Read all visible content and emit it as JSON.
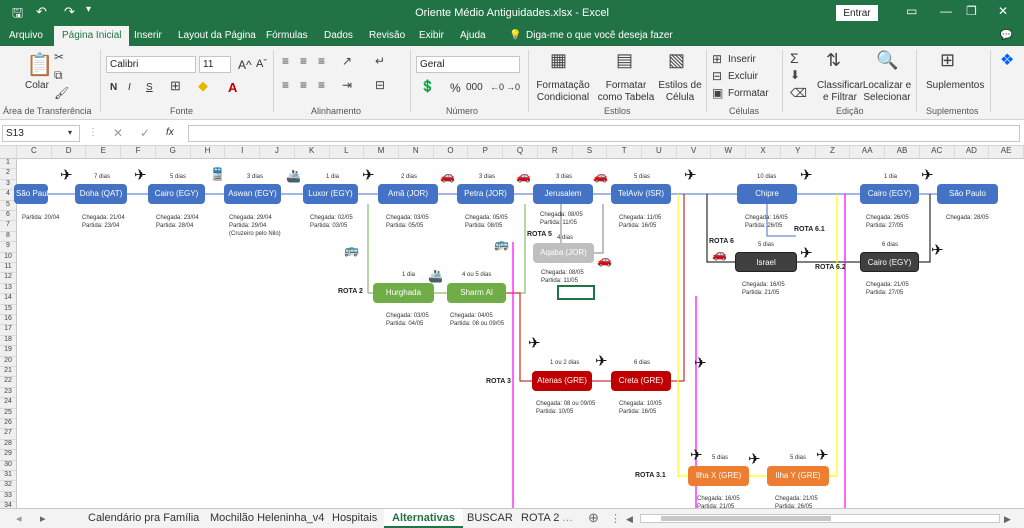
{
  "window": {
    "title": "Oriente Médio Antiguidades.xlsx  -  Excel",
    "signin": "Entrar"
  },
  "tabs": [
    "Arquivo",
    "Página Inicial",
    "Inserir",
    "Layout da Página",
    "Fórmulas",
    "Dados",
    "Revisão",
    "Exibir",
    "Ajuda",
    "Diga-me o que você deseja fazer"
  ],
  "ribbon": {
    "paste": "Colar",
    "clipboard": "Área de Transferência",
    "font_name": "Calibri",
    "font_size": "11",
    "bold": "N",
    "italic": "I",
    "underline": "S",
    "font_group": "Fonte",
    "align_group": "Alinhamento",
    "number_format": "Geral",
    "percent": "%",
    "thousands": "000",
    "number_group": "Número",
    "cond_format": "Formatação Condicional",
    "format_table": "Formatar como Tabela",
    "cell_styles": "Estilos de Célula",
    "styles_group": "Estilos",
    "insert": "Inserir",
    "delete": "Excluir",
    "format": "Formatar",
    "cells_group": "Células",
    "sort_filter": "Classificar e Filtrar",
    "find_select": "Localizar e Selecionar",
    "edit_group": "Edição",
    "addins": "Suplementos",
    "addins_group": "Suplementos"
  },
  "formula_bar": {
    "name_box": "S13",
    "fx": "fx",
    "value": ""
  },
  "columns": [
    "C",
    "D",
    "E",
    "F",
    "G",
    "H",
    "I",
    "J",
    "K",
    "L",
    "M",
    "N",
    "O",
    "P",
    "Q",
    "R",
    "S",
    "T",
    "U",
    "V",
    "W",
    "X",
    "Y",
    "Z",
    "AA",
    "AB",
    "AC",
    "AD",
    "AE"
  ],
  "rows": [
    "1",
    "2",
    "3",
    "4",
    "5",
    "6",
    "7",
    "8",
    "9",
    "10",
    "11",
    "12",
    "13",
    "14",
    "15",
    "16",
    "17",
    "18",
    "19",
    "20",
    "21",
    "22",
    "23",
    "24",
    "25",
    "26",
    "27",
    "28",
    "29",
    "30",
    "31",
    "32",
    "33",
    "34"
  ],
  "nodes": {
    "saopaulo1": "São Paulo",
    "doha": "Doha (QAT)",
    "cairo1": "Cairo (EGY)",
    "aswan": "Aswan (EGY)",
    "luxor": "Luxor (EGY)",
    "ama": "Amã (JOR)",
    "petra": "Petra (JOR)",
    "jerusalem": "Jerusalem",
    "telaviv": "TelAviv (ISR)",
    "chipre": "Chipre",
    "cairo2": "Cairo (EGY)",
    "saopaulo2": "São Paulo",
    "aqaba": "Aqaba (JOR)",
    "israel": "Israel",
    "cairo3": "Cairo (EGY)",
    "hurghada": "Hurghada",
    "sharm": "Sharm Al",
    "atenas": "Atenas (GRE)",
    "creta": "Creta (GRE)",
    "ilhax": "Ilha X (GRE)",
    "ilhay": "Ilha Y (GRE)"
  },
  "durations": {
    "doha": "7 dias",
    "cairo1": "5 dias",
    "aswan": "3 dias",
    "luxor": "1 dia",
    "ama": "2 dias",
    "petra": "3 dias",
    "jerusalem": "3 dias",
    "telaviv": "5 dias",
    "chipre": "10 dias",
    "cairo2": "1 dia",
    "aqaba": "4 dias",
    "israel": "5 dias",
    "cairo3": "6 dias",
    "hurghada": "1 dia",
    "sharm": "4 ou 5 dias",
    "atenas": "1 ou 2 dias",
    "creta": "6 dias",
    "ilhax": "5 dias",
    "ilhay": "5 dias"
  },
  "info": {
    "saopaulo1": "Partida: 20/04",
    "doha": "Chegada: 21/04\nPartida: 23/04",
    "cairo1": "Chegada: 23/04\nPartida: 28/04",
    "aswan": "Chegada: 29/04\nPartida: 29/04\n(Cruzeiro pelo Nilo)",
    "luxor": "Chegada: 02/05\nPartida: 03/05",
    "ama": "Chegada: 03/05\nPartida: 05/05",
    "petra": "Chegada: 05/05\nPartida: 08/05",
    "jerusalem": "Chegada: 08/05\nPartida: 11/05",
    "telaviv": "Chegada: 11/05\nPartida: 16/05",
    "chipre": "Chegada: 16/05\nPartida: 26/05",
    "cairo2": "Chegada: 26/05\nPartida: 27/05",
    "saopaulo2": "Chegada: 28/05",
    "aqaba": "Chegada: 08/05\nPartida: 11/05",
    "israel": "Chegada: 16/05\nPartida: 21/05",
    "cairo3": "Chegada: 21/05\nPartida: 27/05",
    "hurghada": "Chegada: 03/05\nPartida: 04/05",
    "sharm": "Chegada: 04/05\nPartida: 08 ou 09/05",
    "atenas": "Chegada: 08 ou 09/05\nPartida: 10/05",
    "creta": "Chegada: 10/05\nPartida: 16/05",
    "ilhax": "Chegada: 16/05\nPartida: 21/05",
    "ilhay": "Chegada: 21/05\nPartida: 26/05"
  },
  "routes": {
    "r2": "ROTA 2",
    "r3": "ROTA 3",
    "r5": "ROTA 5",
    "r6": "ROTA 6",
    "r61": "ROTA 6.1",
    "r62": "ROTA 6.2",
    "r31": "ROTA 3.1"
  },
  "sheet_tabs": [
    "Calendário pra Família",
    "Mochilão Heleninha_v4",
    "Hospitais",
    "Alternativas",
    "BUSCAR",
    "ROTA 2"
  ],
  "colors": {
    "excel_green": "#217346",
    "blue": "#4472c4",
    "green": "#70ad47",
    "red": "#c00000",
    "orange": "#ed7d31",
    "gray": "#bfbfbf",
    "dark": "#404040",
    "yellow": "#ffff00",
    "magenta": "#ff00ff"
  }
}
